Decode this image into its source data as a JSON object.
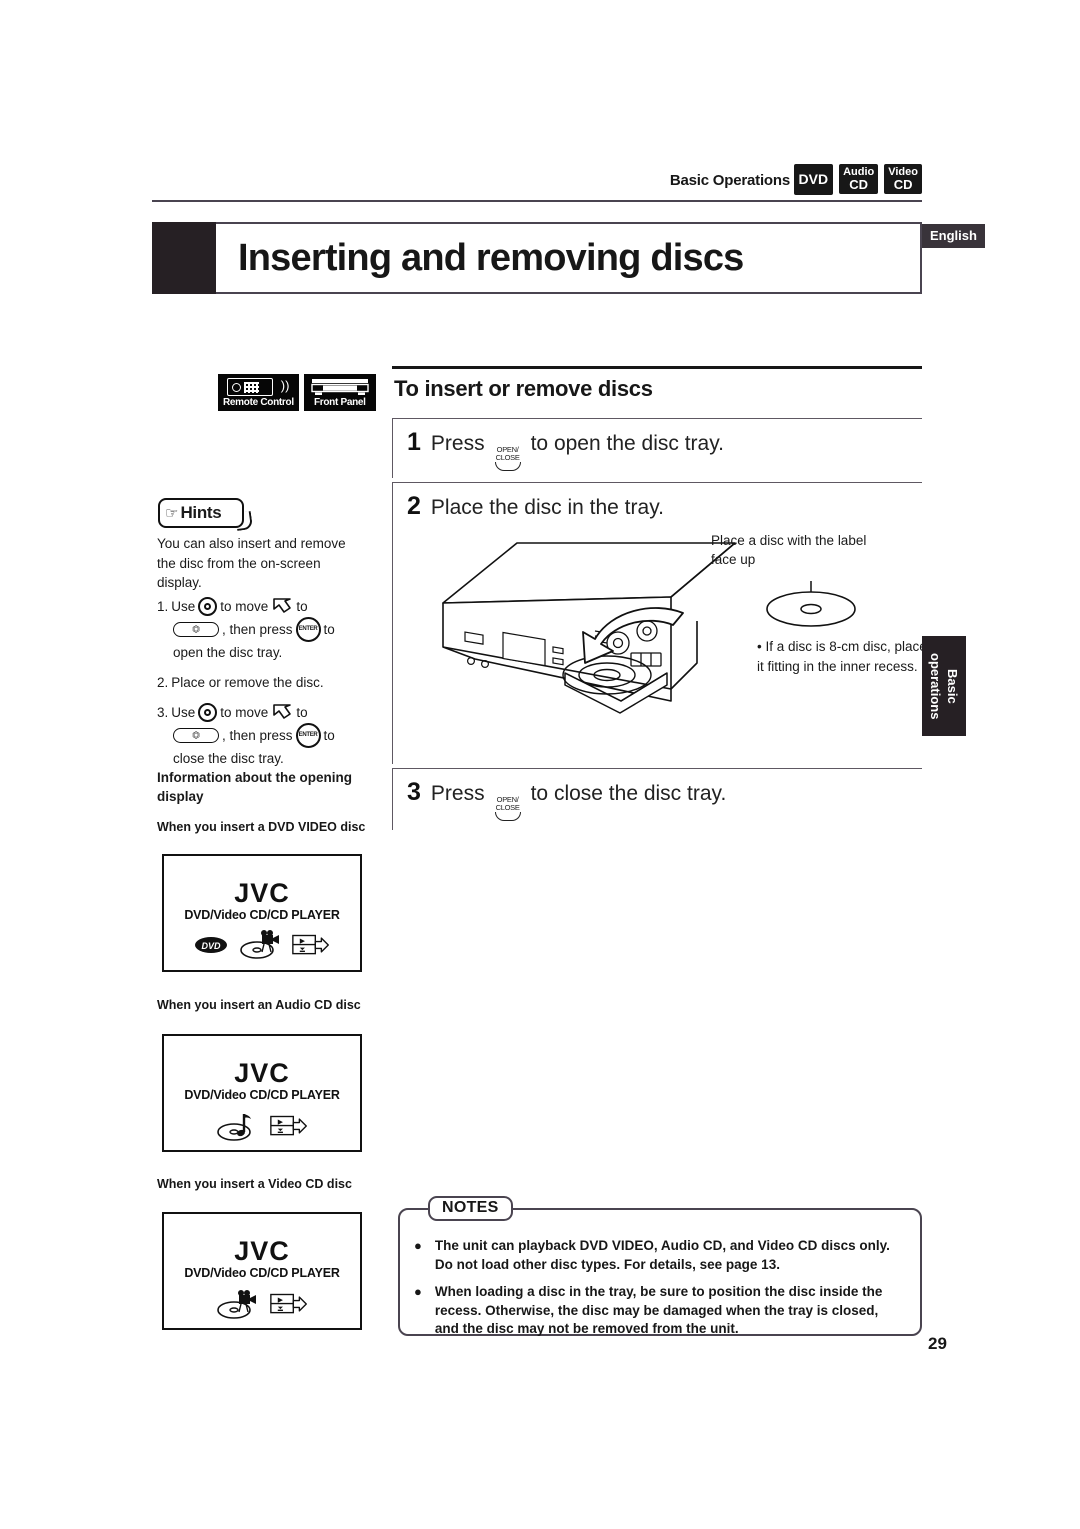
{
  "header": {
    "section_label": "Basic Operations",
    "disc_badges": [
      {
        "name": "dvd-badge",
        "line1": "",
        "line2": "DVD"
      },
      {
        "name": "audio-cd-badge",
        "line1": "Audio",
        "line2": "CD"
      },
      {
        "name": "video-cd-badge",
        "line1": "Video",
        "line2": "CD"
      }
    ],
    "title": "Inserting and removing discs",
    "language_tab": "English"
  },
  "control_badges": [
    {
      "name": "remote-control-badge",
      "label": "Remote Control"
    },
    {
      "name": "front-panel-badge",
      "label": "Front Panel"
    }
  ],
  "hints": {
    "label": "Hints",
    "intro": "You can also insert and remove the disc from the on-screen display.",
    "steps": [
      {
        "num": "1.",
        "t1": "Use",
        "t2": "to move",
        "t3": "to",
        "t4": ", then press",
        "t5": "to",
        "t6": "open the disc tray."
      },
      {
        "num": "2.",
        "text": "Place or remove the disc."
      },
      {
        "num": "3.",
        "t1": "Use",
        "t2": "to move",
        "t3": "to",
        "t4": ", then press",
        "t5": "to",
        "t6": "close the disc tray."
      }
    ],
    "enter_label": "ENTER"
  },
  "info_section": {
    "heading": "Information about the opening display",
    "screens": [
      {
        "caption": "When you insert a DVD VIDEO disc",
        "brand": "JVC",
        "subtitle": "DVD/Video CD/CD PLAYER",
        "icons": [
          "dvd-logo",
          "disc-with-camera",
          "menu-eject-icon"
        ]
      },
      {
        "caption": "When you insert an Audio CD disc",
        "brand": "JVC",
        "subtitle": "DVD/Video CD/CD PLAYER",
        "icons": [
          "disc-with-note",
          "menu-eject-icon"
        ]
      },
      {
        "caption": "When you insert a Video CD disc",
        "brand": "JVC",
        "subtitle": "DVD/Video CD/CD PLAYER",
        "icons": [
          "disc-with-camera",
          "menu-eject-icon"
        ]
      }
    ]
  },
  "main": {
    "section_title": "To insert or remove discs",
    "steps": [
      {
        "num": "1",
        "pre": "Press",
        "button_l1": "OPEN/",
        "button_l2": "CLOSE",
        "post": "to open the disc tray."
      },
      {
        "num": "2",
        "pre": "Place the disc in the tray.",
        "button_l1": "",
        "button_l2": "",
        "post": ""
      },
      {
        "num": "3",
        "pre": "Press",
        "button_l1": "OPEN/",
        "button_l2": "CLOSE",
        "post": "to close the disc tray."
      }
    ],
    "callout_label": "Place a disc with the label face up",
    "callout_bullet": "• If a disc is 8-cm disc, place it fitting in the inner recess."
  },
  "side_tab": "Basic\noperations",
  "notes": {
    "label": "NOTES",
    "items": [
      "The unit can playback DVD VIDEO, Audio CD, and Video CD discs only.  Do not load other disc types. For details, see page 13.",
      "When loading a disc in the tray, be sure to position the disc inside the recess. Otherwise, the disc may be damaged when the tray is closed, and the disc may not be removed from the unit."
    ],
    "bullet": "●"
  },
  "page_number": "29"
}
